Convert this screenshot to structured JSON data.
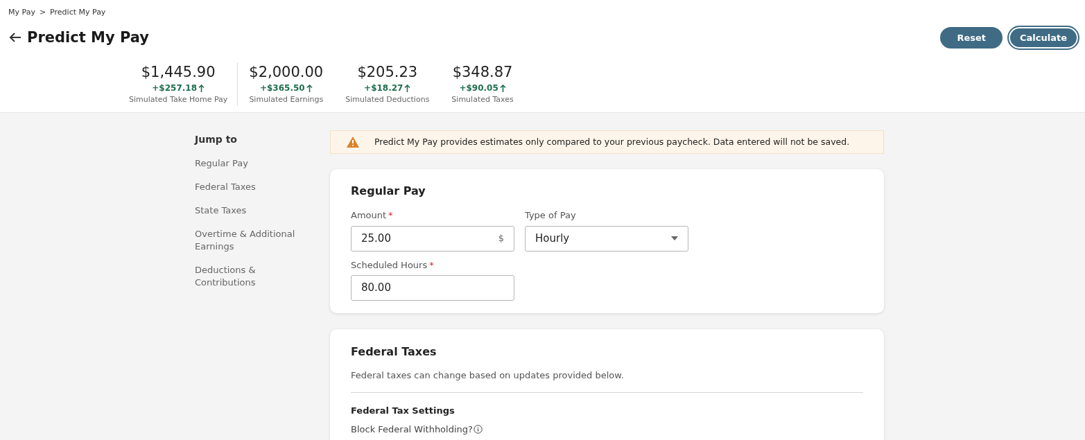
{
  "breadcrumb": [
    {
      "label": "My Pay"
    },
    {
      "label": "Predict My Pay"
    }
  ],
  "breadcrumb_separator": ">",
  "title": "Predict My Pay",
  "actions": [
    {
      "label": "Reset",
      "kind": "plain"
    },
    {
      "label": "Calculate",
      "kind": "focused"
    }
  ],
  "summary": [
    {
      "amount": "$1,445.90",
      "change": "+$257.18",
      "label": "Simulated Take Home Pay"
    },
    {
      "amount": "$2,000.00",
      "change": "+$365.50",
      "label": "Simulated Earnings"
    },
    {
      "amount": "$205.23",
      "change": "+$18.27",
      "label": "Simulated Deductions"
    },
    {
      "amount": "$348.87",
      "change": "+$90.05",
      "label": "Simulated Taxes"
    }
  ],
  "jump_to": {
    "title": "Jump to",
    "items": [
      {
        "label": "Regular Pay"
      },
      {
        "label": "Federal Taxes"
      },
      {
        "label": "State Taxes"
      },
      {
        "label": "Overtime & Additional Earnings"
      },
      {
        "label": "Deductions & Contributions"
      }
    ]
  },
  "notice": "Predict My Pay provides estimates only compared to your previous paycheck. Data entered will not be saved.",
  "regular_pay": {
    "title": "Regular Pay",
    "fields": [
      {
        "label": "Amount",
        "required_mark": "*",
        "value": "25.00",
        "suffix": "$",
        "kind": "text"
      },
      {
        "label": "Type of Pay",
        "value": "Hourly",
        "kind": "select"
      },
      {
        "label": "Scheduled Hours",
        "required_mark": "*",
        "value": "80.00",
        "kind": "text"
      }
    ]
  },
  "federal_taxes": {
    "title": "Federal Taxes",
    "description": "Federal taxes can change based on updates provided below.",
    "settings_title": "Federal Tax Settings",
    "question": "Block Federal Withholding?"
  }
}
